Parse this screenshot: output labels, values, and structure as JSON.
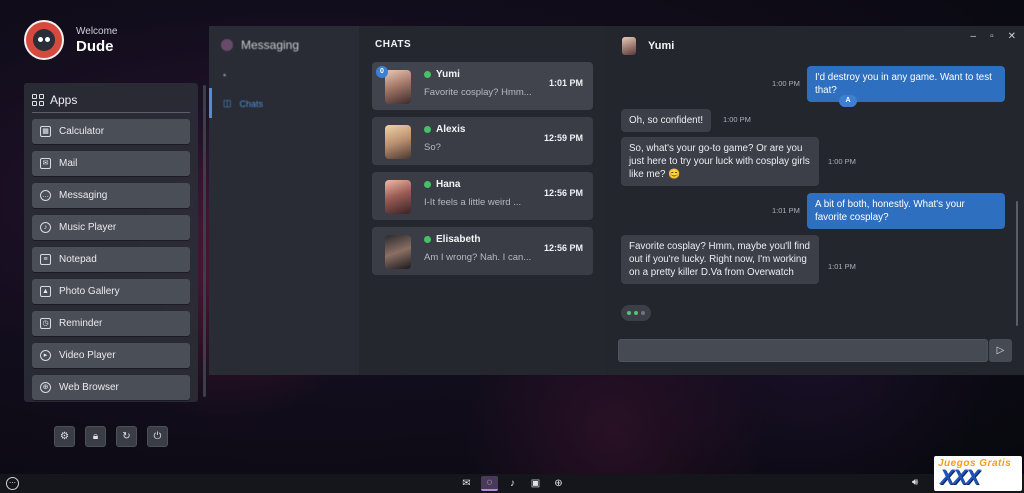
{
  "user": {
    "welcome": "Welcome",
    "name": "Dude"
  },
  "apps_panel": {
    "title": "Apps",
    "items": [
      {
        "label": "Calculator",
        "icon": "calculator-icon"
      },
      {
        "label": "Mail",
        "icon": "mail-icon"
      },
      {
        "label": "Messaging",
        "icon": "messaging-icon"
      },
      {
        "label": "Music Player",
        "icon": "music-icon"
      },
      {
        "label": "Notepad",
        "icon": "notepad-icon"
      },
      {
        "label": "Photo Gallery",
        "icon": "photo-icon"
      },
      {
        "label": "Reminder",
        "icon": "reminder-icon"
      },
      {
        "label": "Video Player",
        "icon": "video-icon"
      },
      {
        "label": "Web Browser",
        "icon": "globe-icon"
      }
    ]
  },
  "controls": [
    "settings-icon",
    "lock-icon",
    "refresh-icon",
    "power-icon"
  ],
  "messaging": {
    "title": "Messaging",
    "nav": {
      "chats_label": "Chats"
    },
    "chats_heading": "CHATS",
    "chats": [
      {
        "name": "Yumi",
        "preview": "Favorite cosplay? Hmm...",
        "time": "1:01 PM",
        "unread": "0",
        "online": true
      },
      {
        "name": "Alexis",
        "preview": "So?",
        "time": "12:59 PM",
        "online": true
      },
      {
        "name": "Hana",
        "preview": "I-It feels a little weird ...",
        "time": "12:56 PM",
        "online": true
      },
      {
        "name": "Elisabeth",
        "preview": "Am I wrong? Nah. I can...",
        "time": "12:56 PM",
        "online": true
      }
    ],
    "conversation": {
      "contact": "Yumi",
      "messages": [
        {
          "dir": "out",
          "text": "I'd destroy you in any game. Want to test that?",
          "time": "1:00 PM",
          "badge": "A"
        },
        {
          "dir": "in",
          "text": "Oh, so confident!",
          "time": "1:00 PM"
        },
        {
          "dir": "in",
          "text": "So, what's your go-to game? Or are you just here to try your luck with cosplay girls like me? 😊",
          "time": "1:00 PM"
        },
        {
          "dir": "out",
          "text": "A bit of both, honestly. What's your favorite cosplay?",
          "time": "1:01 PM"
        },
        {
          "dir": "in",
          "text": "Favorite cosplay? Hmm, maybe you'll find out if you're lucky. Right now, I'm working on a pretty killer D.Va from Overwatch",
          "time": "1:01 PM"
        }
      ],
      "composer_value": "",
      "typing": true
    }
  },
  "taskbar": {
    "icons": [
      "mail-icon",
      "messaging-icon",
      "music-icon",
      "photo-icon",
      "globe-icon"
    ],
    "active": "messaging-icon"
  },
  "watermark": {
    "top": "Juegos Gratis",
    "main": "XXX"
  },
  "colors": {
    "accent": "#2f6fbf",
    "online": "#47c06a",
    "panel": "#2a2d36"
  }
}
